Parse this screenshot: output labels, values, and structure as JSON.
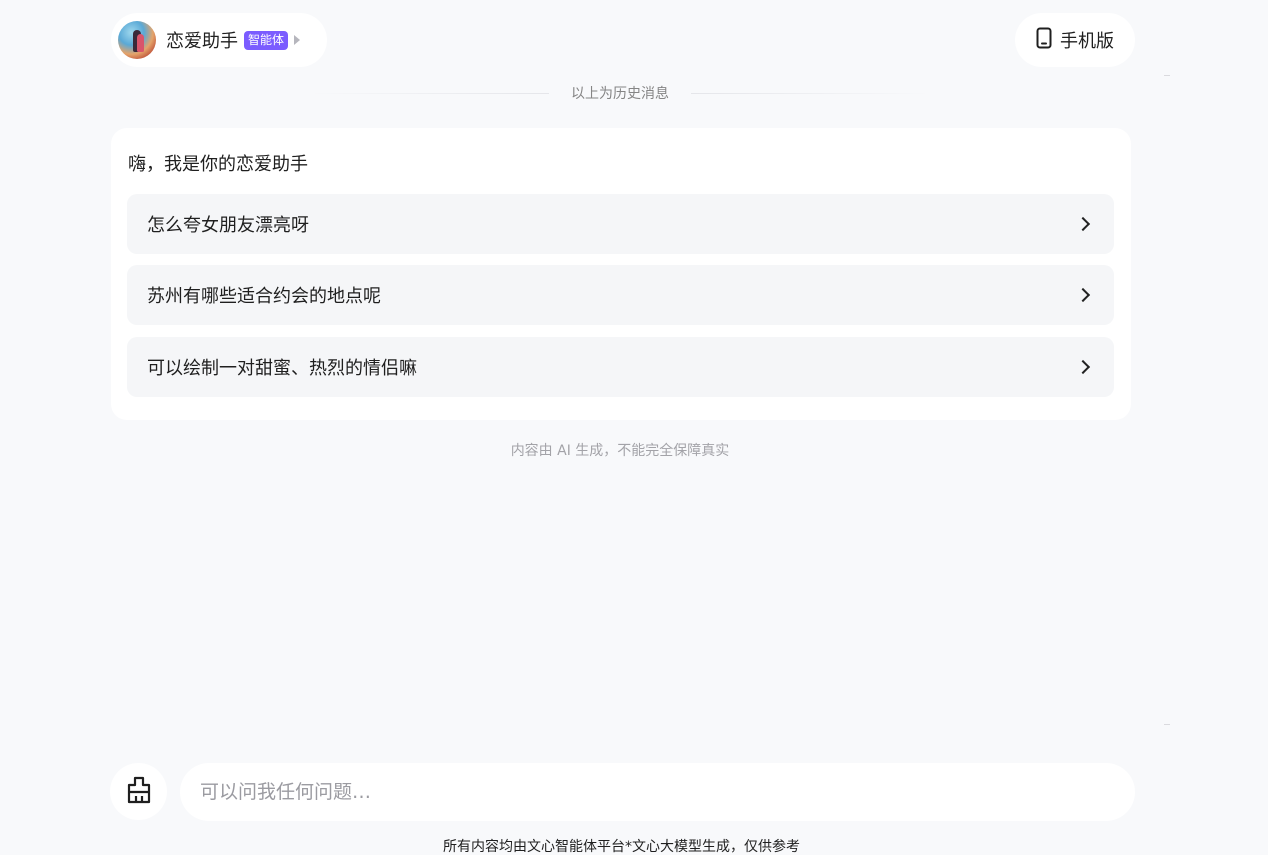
{
  "header": {
    "agent_name": "恋爱助手",
    "agent_badge": "智能体",
    "mobile_label": "手机版"
  },
  "history_divider": "以上为历史消息",
  "welcome": {
    "greeting": "嗨，我是你的恋爱助手",
    "suggestions": [
      "怎么夸女朋友漂亮呀",
      "苏州有哪些适合约会的地点呢",
      "可以绘制一对甜蜜、热烈的情侣嘛"
    ]
  },
  "ai_note": "内容由 AI 生成，不能完全保障真实",
  "input": {
    "placeholder": "可以问我任何问题…"
  },
  "footer": "所有内容均由文心智能体平台*文心大模型生成，仅供参考",
  "colors": {
    "page_bg": "#f8f9fb",
    "badge": "#7b5cff",
    "card": "#ffffff",
    "suggestion_bg": "#f5f6f8"
  },
  "icons": {
    "mobile": "mobile-phone-icon",
    "clear": "broom-icon",
    "chevron": "chevron-right-icon",
    "caret": "caret-right-icon"
  }
}
